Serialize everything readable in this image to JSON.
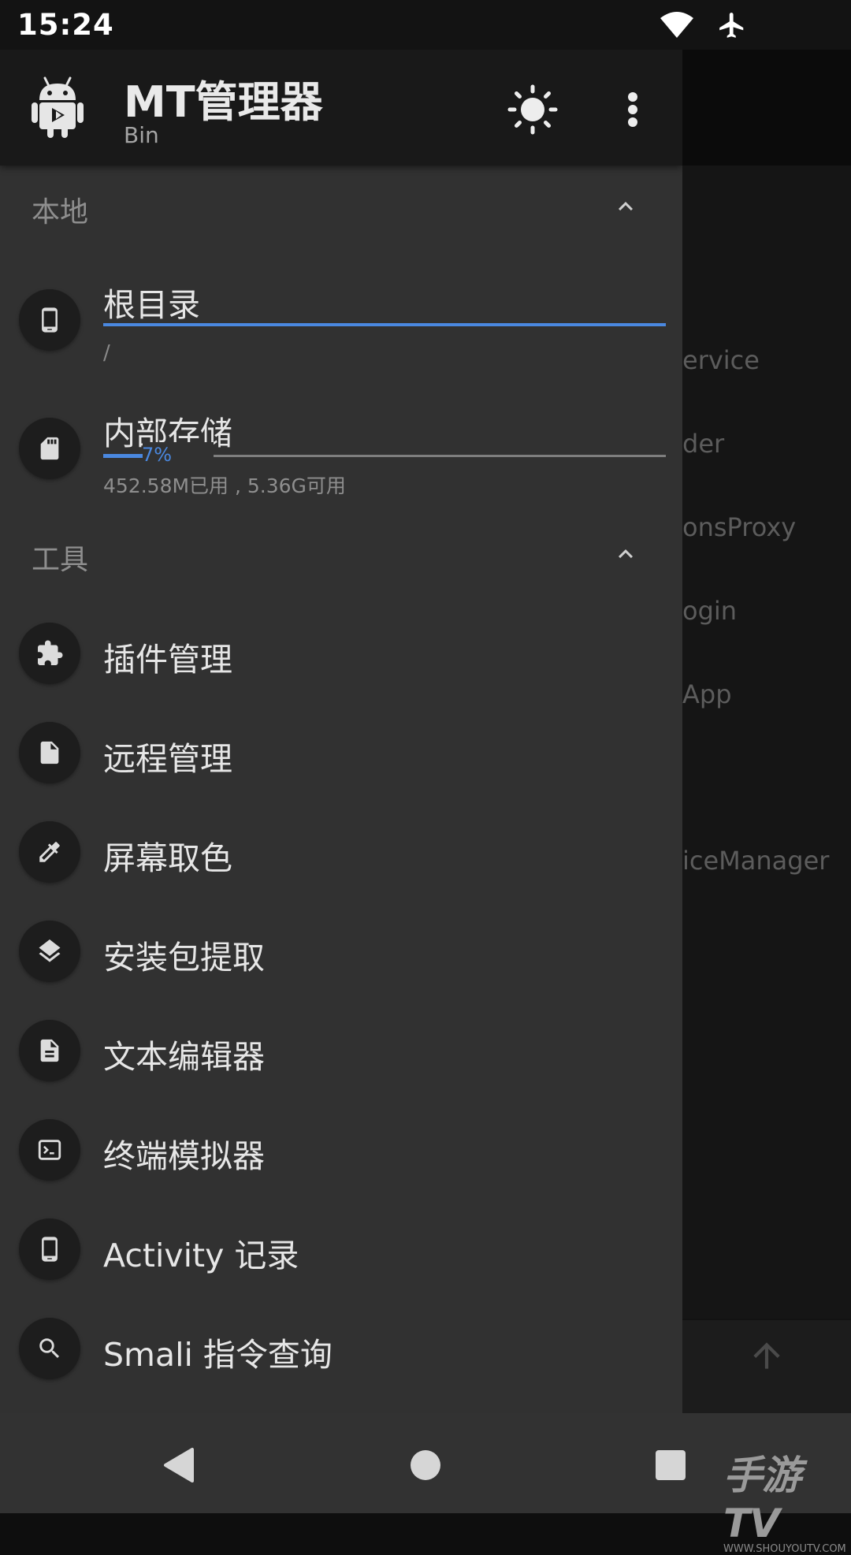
{
  "status_bar": {
    "time": "15:24"
  },
  "background": {
    "visible_fragments": [
      "ervice",
      "der",
      "onsProxy",
      "ogin",
      "App",
      "iceManager"
    ]
  },
  "drawer": {
    "header": {
      "title": "MT管理器",
      "subtitle": "Bin"
    },
    "local_section": {
      "title": "本地",
      "items": [
        {
          "label": "根目录",
          "path": "/",
          "icon": "phone-icon"
        },
        {
          "label": "内部存储",
          "percent_label": "7%",
          "percent": 7,
          "usage": "452.58M已用 , 5.36G可用",
          "icon": "sd-card-icon"
        }
      ]
    },
    "tools_section": {
      "title": "工具",
      "items": [
        {
          "label": "插件管理",
          "icon": "puzzle-icon"
        },
        {
          "label": "远程管理",
          "icon": "file-icon"
        },
        {
          "label": "屏幕取色",
          "icon": "eyedropper-icon"
        },
        {
          "label": "安装包提取",
          "icon": "layers-icon"
        },
        {
          "label": "文本编辑器",
          "icon": "document-icon"
        },
        {
          "label": "终端模拟器",
          "icon": "terminal-icon"
        },
        {
          "label": "Activity 记录",
          "icon": "phone-icon"
        },
        {
          "label": "Smali 指令查询",
          "icon": "search-icon"
        }
      ]
    }
  },
  "watermark": {
    "main": "手游TV",
    "sub": "WWW.SHOUYOUTV.COM"
  },
  "colors": {
    "accent": "#4a88e0",
    "drawer_bg": "#313131",
    "header_bg": "#191919"
  }
}
